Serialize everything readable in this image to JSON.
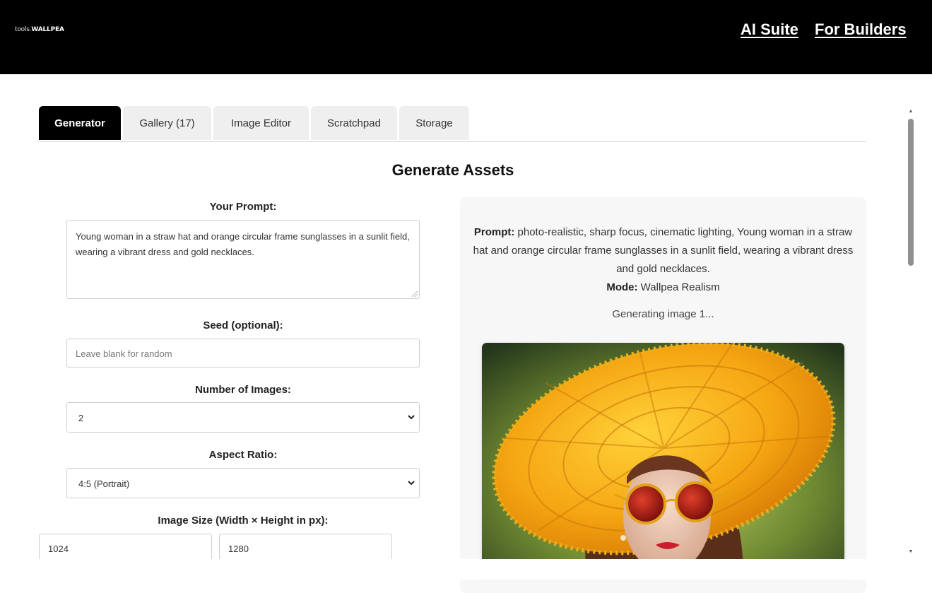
{
  "header": {
    "logo_prefix": "tools.",
    "logo_brand": "WALLPEA",
    "nav": [
      "AI Suite",
      "For Builders"
    ]
  },
  "tabs": [
    {
      "label": "Generator",
      "active": true
    },
    {
      "label": "Gallery (17)",
      "active": false
    },
    {
      "label": "Image Editor",
      "active": false
    },
    {
      "label": "Scratchpad",
      "active": false
    },
    {
      "label": "Storage",
      "active": false
    }
  ],
  "main": {
    "title": "Generate Assets"
  },
  "form": {
    "prompt_label": "Your Prompt:",
    "prompt_value": "Young woman in a straw hat and orange circular frame sunglasses in a sunlit field, wearing a vibrant dress and gold necklaces.",
    "seed_label": "Seed (optional):",
    "seed_placeholder": "Leave blank for random",
    "num_images_label": "Number of Images:",
    "num_images_value": "2",
    "aspect_label": "Aspect Ratio:",
    "aspect_value": "4:5 (Portrait)",
    "size_label": "Image Size (Width × Height in px):",
    "width_value": "1024",
    "height_value": "1280"
  },
  "result": {
    "prompt_key": "Prompt:",
    "prompt_text": "photo-realistic, sharp focus, cinematic lighting, Young woman in a straw hat and orange circular frame sunglasses in a sunlit field, wearing a vibrant dress and gold necklaces.",
    "mode_key": "Mode:",
    "mode_text": "Wallpea Realism",
    "status": "Generating image 1..."
  },
  "colors": {
    "header_bg": "#000000",
    "active_tab_bg": "#000000",
    "tab_bg": "#efefef",
    "panel_bg": "#f7f7f7"
  }
}
